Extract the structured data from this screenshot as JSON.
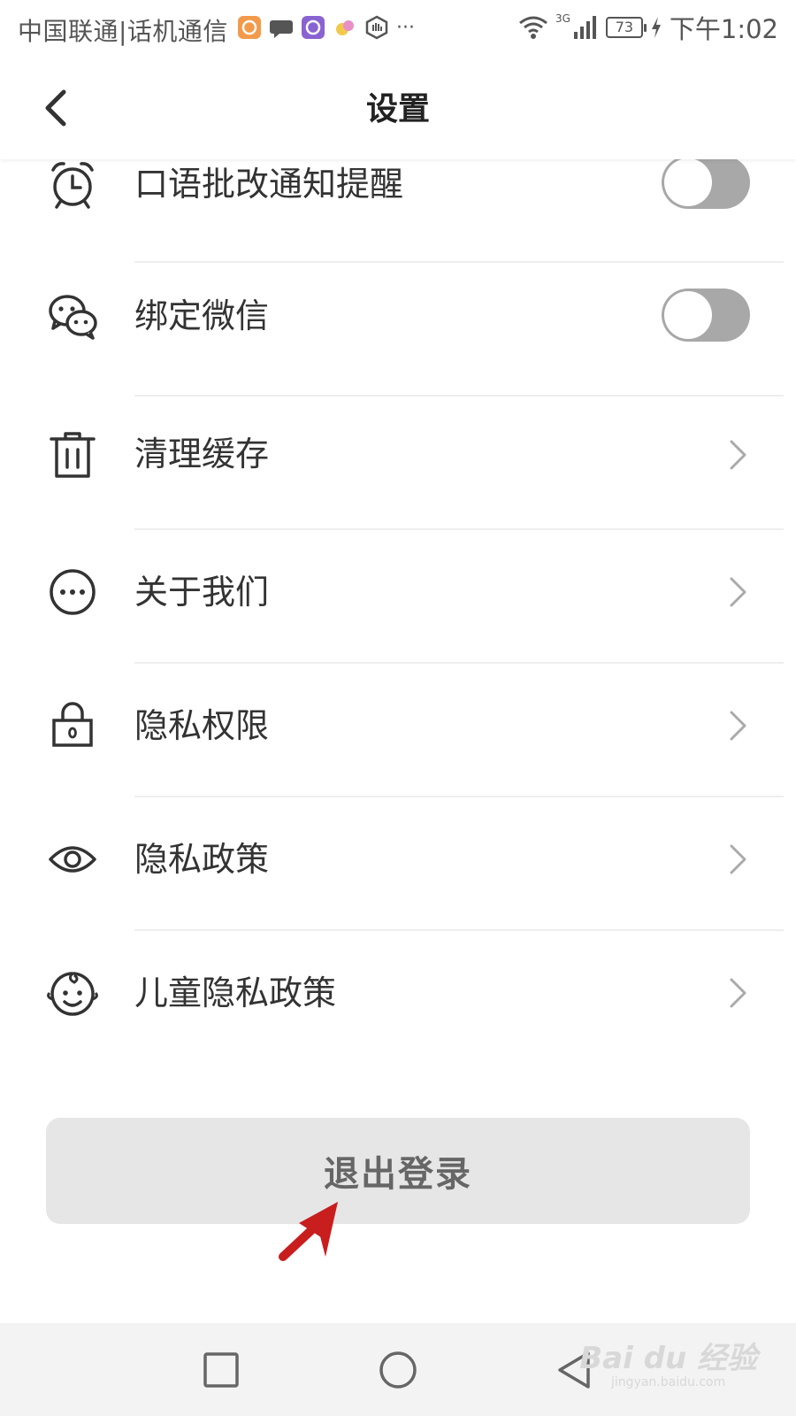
{
  "status_bar": {
    "carrier": "中国联通|话机通信",
    "more": "···",
    "network": "3G",
    "battery": "73",
    "time": "下午1:02"
  },
  "header": {
    "title": "设置"
  },
  "settings": {
    "items": [
      {
        "label": "口语批改通知提醒",
        "icon": "alarm-clock-icon",
        "control": "toggle",
        "on": false
      },
      {
        "label": "绑定微信",
        "icon": "wechat-icon",
        "control": "toggle",
        "on": false
      },
      {
        "label": "清理缓存",
        "icon": "trash-icon",
        "control": "chevron"
      },
      {
        "label": "关于我们",
        "icon": "more-circle-icon",
        "control": "chevron"
      },
      {
        "label": "隐私权限",
        "icon": "lock-icon",
        "control": "chevron"
      },
      {
        "label": "隐私政策",
        "icon": "eye-icon",
        "control": "chevron"
      },
      {
        "label": "儿童隐私政策",
        "icon": "child-face-icon",
        "control": "chevron"
      }
    ]
  },
  "logout": {
    "label": "退出登录"
  },
  "watermark": {
    "logo": "Bai du 经验",
    "url": "jingyan.baidu.com"
  },
  "colors": {
    "toggle_off": "#a8a8a8",
    "logout_bg": "#e6e6e6",
    "annotation_arrow": "#c81e1e"
  }
}
